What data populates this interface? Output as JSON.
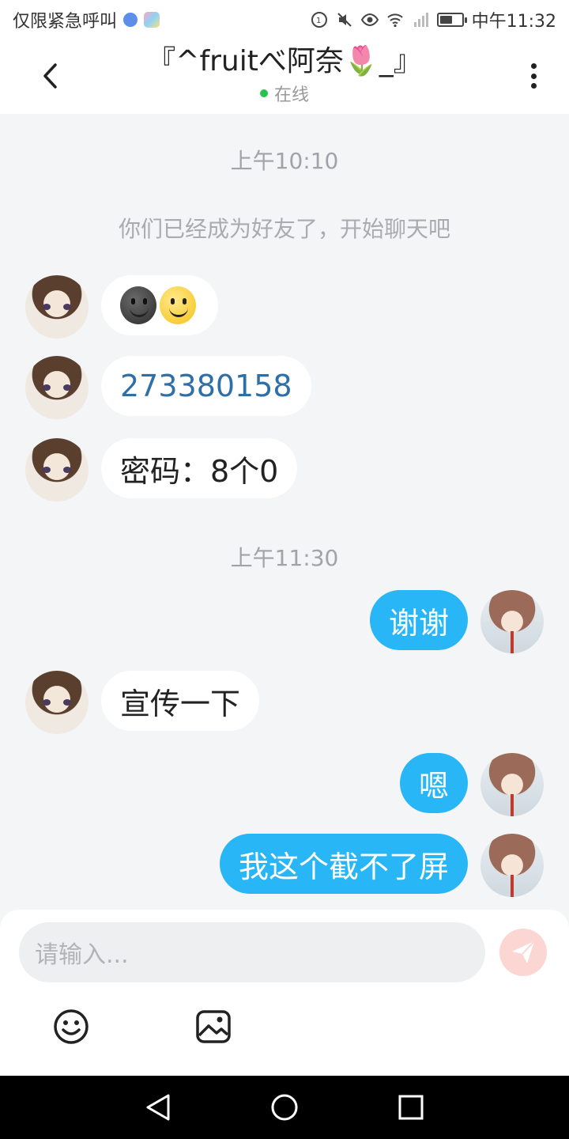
{
  "status_bar": {
    "carrier": "仅限紧急呼叫",
    "time": "中午11:32"
  },
  "header": {
    "title": "『^fruitべ阿奈🌷_』",
    "status": "在线"
  },
  "chat": {
    "timestamps": [
      "上午10:10",
      "上午11:30"
    ],
    "system_notice": "你们已经成为好友了，开始聊天吧",
    "messages": [
      {
        "from": "contact",
        "text": ""
      },
      {
        "from": "contact",
        "text": "273380158"
      },
      {
        "from": "contact",
        "text": "密码：8个0"
      },
      {
        "from": "me",
        "text": "谢谢"
      },
      {
        "from": "contact",
        "text": "宣传一下"
      },
      {
        "from": "me",
        "text": "嗯"
      },
      {
        "from": "me",
        "text": "我这个截不了屏"
      }
    ]
  },
  "composer": {
    "placeholder": "请输入..."
  },
  "colors": {
    "outgoing_bubble": "#29b6f6",
    "incoming_bubble": "#ffffff",
    "online_dot": "#27c24c",
    "send_button": "#fbd6d3"
  },
  "icons": [
    "back-icon",
    "more-icon",
    "emoji-icon",
    "image-icon",
    "send-icon",
    "nav-back-icon",
    "nav-home-icon",
    "nav-recents-icon"
  ]
}
